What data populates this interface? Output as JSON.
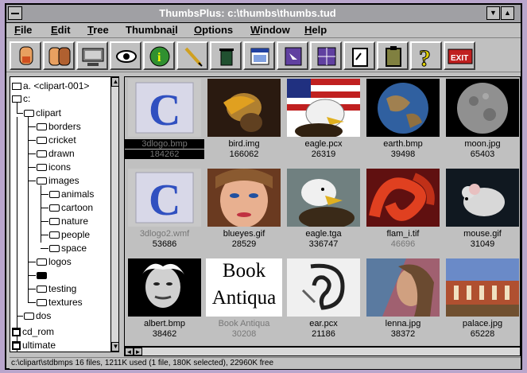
{
  "window": {
    "title": "ThumbsPlus: c:\\thumbs\\thumbs.tud"
  },
  "menu": [
    "File",
    "Edit",
    "Tree",
    "Thumbnail",
    "Options",
    "Window",
    "Help"
  ],
  "toolbar": [
    "open-folder-icon",
    "folders-icon",
    "monitor-icon",
    "eye-icon",
    "info-icon",
    "pencil-icon",
    "trash-icon",
    "window-icon",
    "arrow-icon",
    "grid-icon",
    "clipboard-icon",
    "paste-icon",
    "help-icon",
    "exit-icon"
  ],
  "toolbar_exit_label": "EXIT",
  "tree": {
    "drive_a": "a. <clipart-001>",
    "drive_c": "c:",
    "clipart": "clipart",
    "borders": "borders",
    "cricket": "cricket",
    "drawn": "drawn",
    "icons": "icons",
    "images": "images",
    "animals": "animals",
    "cartoon": "cartoon",
    "nature": "nature",
    "people": "people",
    "space": "space",
    "logos": "logos",
    "stdbmps": "stdbmps",
    "testing": "testing",
    "textures": "textures",
    "dos": "dos",
    "cd_rom": "cd_rom",
    "ultimate": "ultimate"
  },
  "thumbnails": [
    {
      "name": "3dlogo.bmp",
      "size": "184262",
      "selected": true
    },
    {
      "name": "bird.img",
      "size": "166062"
    },
    {
      "name": "eagle.pcx",
      "size": "26319"
    },
    {
      "name": "earth.bmp",
      "size": "39498"
    },
    {
      "name": "moon.jpg",
      "size": "65403"
    },
    {
      "name": "3dlogo2.wmf",
      "size": "53686"
    },
    {
      "name": "blueyes.gif",
      "size": "28529"
    },
    {
      "name": "eagle.tga",
      "size": "336747"
    },
    {
      "name": "flam_i.tif",
      "size": "46696"
    },
    {
      "name": "mouse.gif",
      "size": "31049"
    },
    {
      "name": "albert.bmp",
      "size": "38462"
    },
    {
      "name": "Book Antiqua",
      "size": "30208"
    },
    {
      "name": "ear.pcx",
      "size": "21186"
    },
    {
      "name": "lenna.jpg",
      "size": "38372"
    },
    {
      "name": "palace.jpg",
      "size": "65228"
    }
  ],
  "font_preview": {
    "line1": "Book",
    "line2": "Antiqua"
  },
  "status": "c:\\clipart\\stdbmps 16 files, 1211K used (1 file, 180K selected), 22960K free"
}
